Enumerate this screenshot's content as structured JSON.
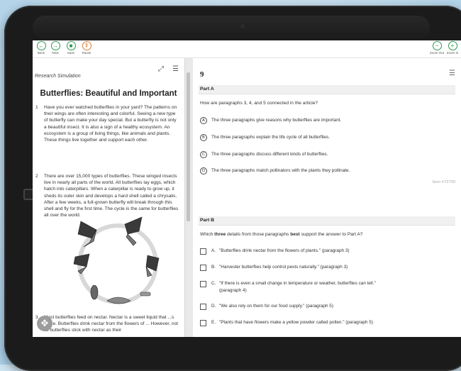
{
  "toolbar": {
    "back": "Back",
    "next": "Next",
    "save": "Save",
    "pause": "Pause",
    "zoom_out": "Zoom Out",
    "zoom_in": "Zoom In"
  },
  "passage": {
    "label": "Research Simulation",
    "title": "Butterflies: Beautiful and Important",
    "paragraphs": [
      {
        "n": "1",
        "text": "Have you ever watched butterflies in your yard? The patterns on their wings are often interesting and colorful. Seeing a new type of butterfly can make your day special. But a butterfly is not only a beautiful insect. It is also a sign of a healthy ecosystem. An ecosystem is a group of living things, like animals and plants. These things live together and support each other."
      },
      {
        "n": "2",
        "text": "There are over 15,000 types of butterflies. These winged insects live in nearly all parts of the world. All butterflies lay eggs, which hatch into caterpillars. When a caterpillar is ready to grow up, it sheds its outer skin and develops a hard shell called a chrysalis. After a few weeks, a full-grown butterfly will break through this shell and fly for the first time. The cycle is the same for butterflies all over the world."
      },
      {
        "n": "3",
        "text": "Most butterflies feed on nectar. Nectar is a sweet liquid that ...s make. Butterflies drink nectar from the flowers of ... However, not all butterflies stick with nectar as their"
      }
    ]
  },
  "question": {
    "number": "9",
    "part_a": {
      "label": "Part A",
      "prompt": "How are paragraphs 3, 4, and 5 connected in the article?",
      "options": [
        {
          "letter": "A",
          "text": "The three paragraphs give reasons why butterflies are important."
        },
        {
          "letter": "B",
          "text": "The three paragraphs explain the life cycle of all butterflies."
        },
        {
          "letter": "C",
          "text": "The three paragraphs discuss different kinds of butterflies."
        },
        {
          "letter": "D",
          "text": "The three paragraphs match pollinators with the plants they pollinate."
        }
      ],
      "item_id": "Item #72790"
    },
    "part_b": {
      "label": "Part B",
      "prompt_pre": "Which ",
      "prompt_b1": "three",
      "prompt_mid": " details from those paragraphs ",
      "prompt_b2": "best",
      "prompt_post": " support the answer to Part A?",
      "options": [
        {
          "letter": "A.",
          "text": "\"Butterflies drink nectar from the flowers of plants.\" (paragraph 3)"
        },
        {
          "letter": "B.",
          "text": "\"Harvester butterflies help control pests naturally.\" (paragraph 3)"
        },
        {
          "letter": "C.",
          "text": "\"If there is even a small change in temperature or weather, butterflies can tell.\"",
          "text2": "(paragraph 4)"
        },
        {
          "letter": "D.",
          "text": "\"We also rely on them for our food supply.\" (paragraph 5)"
        },
        {
          "letter": "E.",
          "text": "\"Plants that have flowers make a yellow powder called pollen.\" (paragraph 5)"
        }
      ]
    }
  }
}
